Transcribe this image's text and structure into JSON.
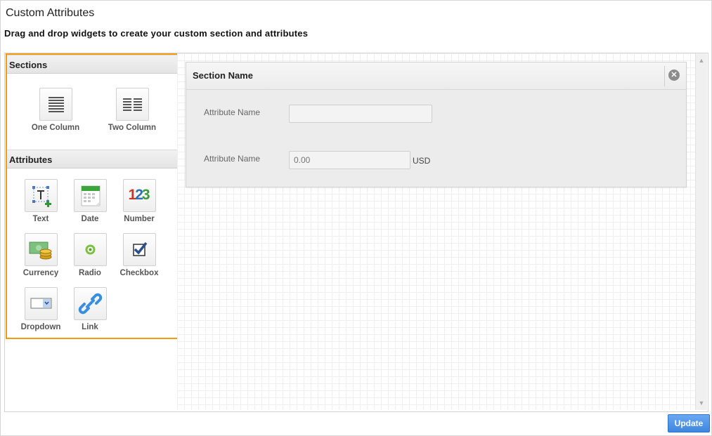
{
  "page": {
    "title": "Custom Attributes",
    "subtitle": "Drag and drop widgets to create your custom section and attributes"
  },
  "palette": {
    "sections_header": "Sections",
    "sections": [
      {
        "label": "One Column",
        "icon": "one-column-icon"
      },
      {
        "label": "Two Column",
        "icon": "two-column-icon"
      }
    ],
    "attributes_header": "Attributes",
    "attributes": [
      {
        "label": "Text",
        "icon": "text-icon"
      },
      {
        "label": "Date",
        "icon": "calendar-icon"
      },
      {
        "label": "Number",
        "icon": "number-icon"
      },
      {
        "label": "Currency",
        "icon": "currency-icon"
      },
      {
        "label": "Radio",
        "icon": "radio-icon"
      },
      {
        "label": "Checkbox",
        "icon": "checkbox-icon"
      },
      {
        "label": "Dropdown",
        "icon": "dropdown-icon"
      },
      {
        "label": "Link",
        "icon": "link-icon"
      }
    ],
    "number_glyphs": [
      "1",
      "2",
      "3"
    ]
  },
  "section": {
    "title": "Section Name",
    "close_icon": "close-icon",
    "attributes": [
      {
        "label": "Attribute Name",
        "value": "",
        "placeholder": ""
      },
      {
        "label": "Attribute Name",
        "value": "",
        "placeholder": "0.00",
        "unit": "USD"
      }
    ]
  },
  "actions": {
    "update_label": "Update"
  },
  "colors": {
    "palette_border": "#f39c12",
    "update_button": "#4a90e2"
  }
}
